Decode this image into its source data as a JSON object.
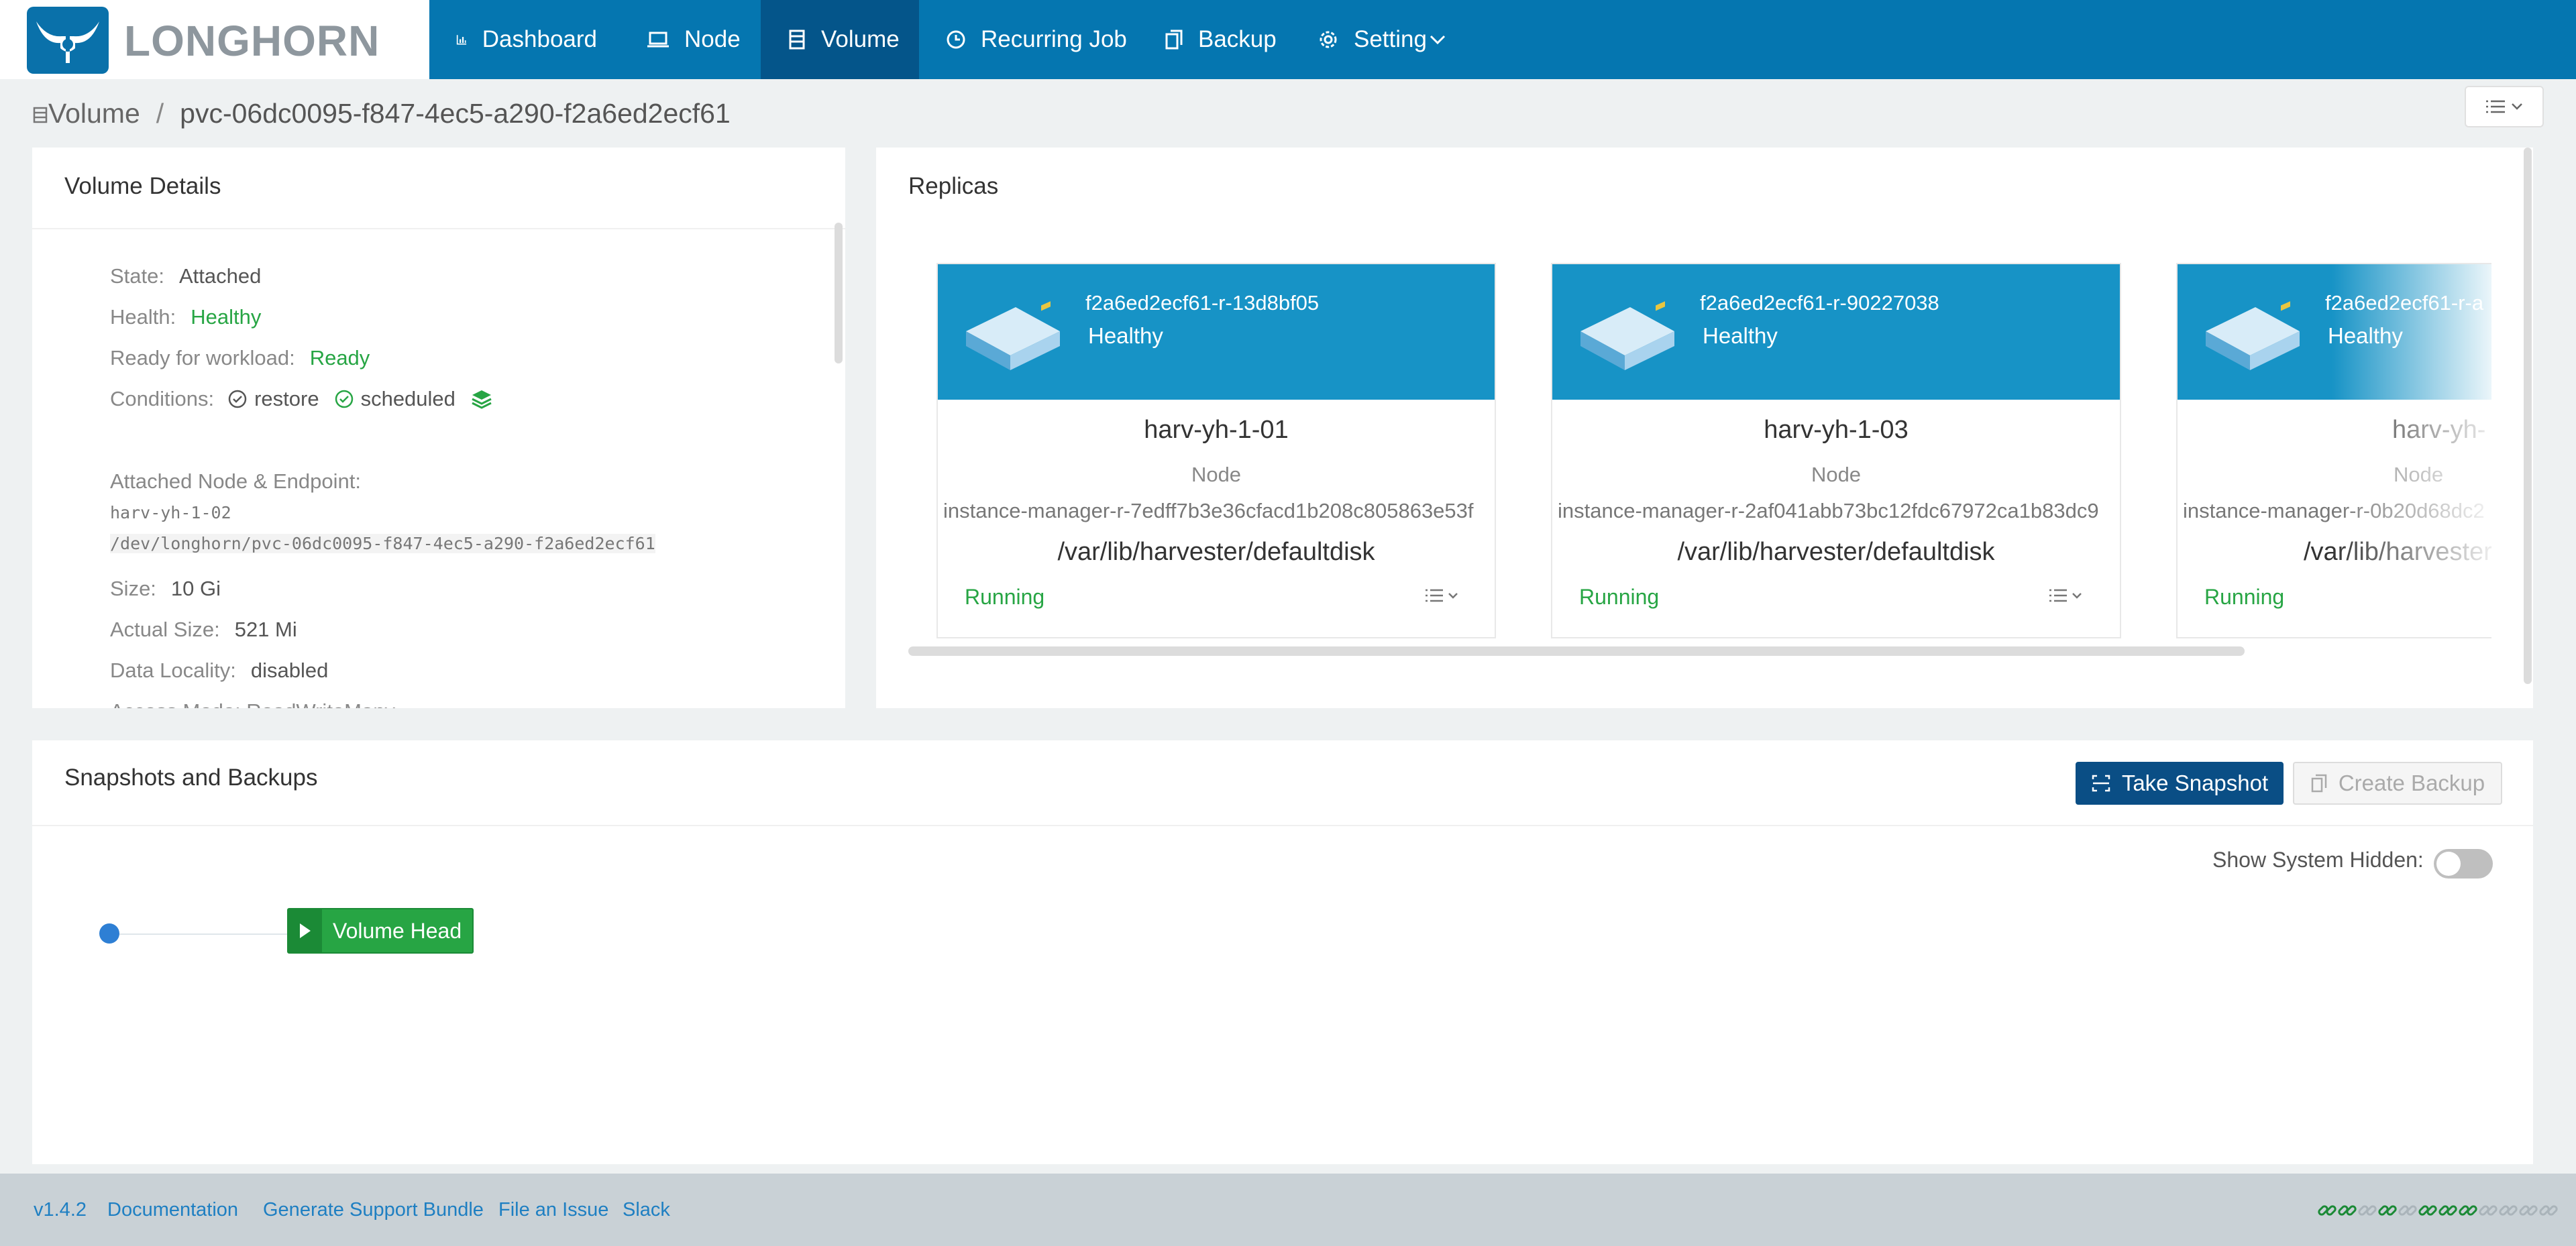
{
  "brand": {
    "name": "LONGHORN"
  },
  "nav": [
    {
      "label": "Dashboard",
      "icon": "bar-chart-icon"
    },
    {
      "label": "Node",
      "icon": "laptop-icon"
    },
    {
      "label": "Volume",
      "icon": "database-icon",
      "active": true
    },
    {
      "label": "Recurring Job",
      "icon": "clock-icon"
    },
    {
      "label": "Backup",
      "icon": "copy-icon"
    },
    {
      "label": "Setting",
      "icon": "gear-icon",
      "has_dropdown": true
    }
  ],
  "breadcrumb": {
    "root": "Volume",
    "separator": "/",
    "current": "pvc-06dc0095-f847-4ec5-a290-f2a6ed2ecf61"
  },
  "details": {
    "title": "Volume Details",
    "state_label": "State:",
    "state": "Attached",
    "health_label": "Health:",
    "health": "Healthy",
    "ready_label": "Ready for workload:",
    "ready": "Ready",
    "conditions_label": "Conditions:",
    "cond_restore": "restore",
    "cond_scheduled": "scheduled",
    "attached_label": "Attached Node & Endpoint:",
    "attached_node": "harv-yh-1-02",
    "endpoint": "/dev/longhorn/pvc-06dc0095-f847-4ec5-a290-f2a6ed2ecf61",
    "size_label": "Size:",
    "size": "10 Gi",
    "actual_label": "Actual Size:",
    "actual": "521 Mi",
    "locality_label": "Data Locality:",
    "locality": "disabled",
    "access_partial": "Access Mode: ReadWriteMany"
  },
  "replicas": {
    "title": "Replicas",
    "node_label": "Node",
    "items": [
      {
        "name": "f2a6ed2ecf61-r-13d8bf05",
        "health": "Healthy",
        "host": "harv-yh-1-01",
        "im": "instance-manager-r-7edff7b3e36cfacd1b208c805863e53f",
        "path": "/var/lib/harvester/defaultdisk",
        "status": "Running"
      },
      {
        "name": "f2a6ed2ecf61-r-90227038",
        "health": "Healthy",
        "host": "harv-yh-1-03",
        "im": "instance-manager-r-2af041abb73bc12fdc67972ca1b83dc9",
        "path": "/var/lib/harvester/defaultdisk",
        "status": "Running"
      },
      {
        "name": "f2a6ed2ecf61-r-a",
        "health": "Healthy",
        "host": "harv-yh-",
        "im": "instance-manager-r-0b20d68dc2",
        "path": "/var/lib/harvester",
        "status": "Running"
      }
    ]
  },
  "snapshots": {
    "title": "Snapshots and Backups",
    "take_snapshot": "Take Snapshot",
    "create_backup": "Create Backup",
    "show_hidden_label": "Show System Hidden:",
    "volume_head": "Volume Head"
  },
  "footer": {
    "version": "v1.4.2",
    "documentation": "Documentation",
    "support_bundle": "Generate Support Bundle",
    "file_issue": "File an Issue",
    "slack": "Slack"
  },
  "colors": {
    "topbar": "#0576b0",
    "active_nav": "#04558a",
    "healthy": "#27a544",
    "replica_header": "#1793c6",
    "primary_button": "#0a4e85"
  }
}
